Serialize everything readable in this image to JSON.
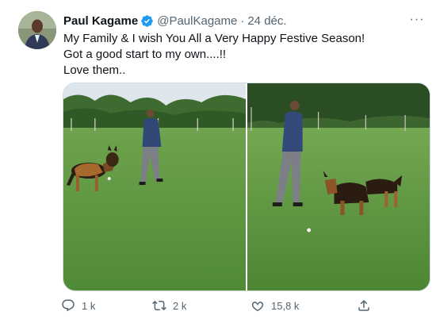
{
  "tweet": {
    "display_name": "Paul Kagame",
    "handle": "@PaulKagame",
    "separator": "·",
    "date": "24 déc.",
    "more_glyph": "···",
    "lines": [
      "My Family & I wish You All a Very Happy Festive Season!",
      "Got a good start to my own....!!",
      "Love them.."
    ],
    "colors": {
      "verified": "#1d9bf0",
      "muted": "#536471",
      "text": "#0f1419"
    }
  },
  "actions": {
    "reply_count": "1 k",
    "retweet_count": "2 k",
    "like_count": "15,8 k",
    "icons": [
      "reply-icon",
      "retweet-icon",
      "like-icon",
      "share-icon"
    ]
  }
}
